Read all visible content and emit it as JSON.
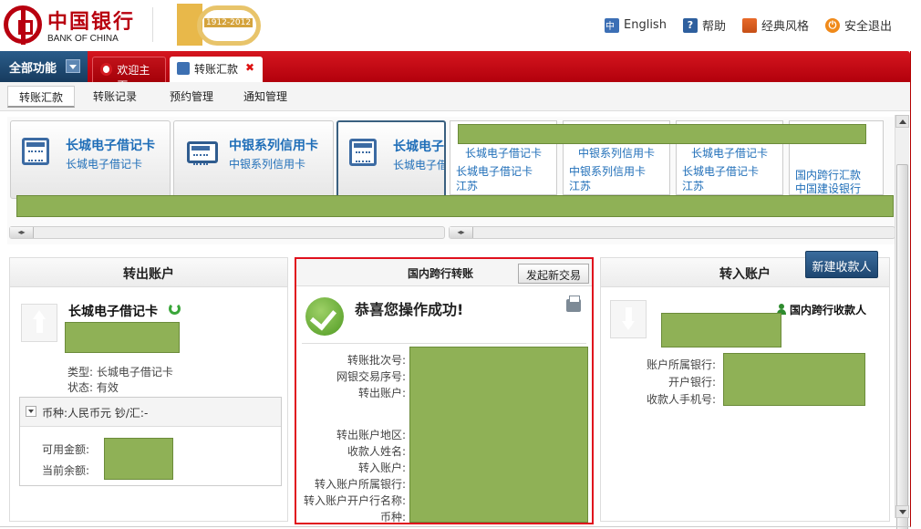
{
  "header": {
    "logo_cn": "中国银行",
    "logo_en": "BANK OF CHINA",
    "anniversary": "1912-2012",
    "links": {
      "english": "English",
      "help": "帮助",
      "classic": "经典风格",
      "logout": "安全退出"
    }
  },
  "tabbar": {
    "all_functions": "全部功能",
    "tabs": [
      {
        "label": "欢迎主页",
        "icon": "home-icon"
      },
      {
        "label": "转账汇款",
        "icon": "transfer-icon",
        "close": "✖"
      }
    ]
  },
  "subnav": [
    "转账汇款",
    "转账记录",
    "预约管理",
    "通知管理"
  ],
  "left_cards": [
    {
      "title": "长城电子借记卡",
      "sub": "长城电子借记卡",
      "icon": "debit-card-icon"
    },
    {
      "title": "中银系列信用卡",
      "sub": "中银系列信用卡",
      "icon": "credit-card-icon"
    },
    {
      "title": "长城电子",
      "sub": "长城电子借",
      "icon": "debit-card-icon"
    }
  ],
  "right_cards": [
    {
      "title": "长城电子借记卡",
      "a": "长城电子借记卡",
      "b": "江苏"
    },
    {
      "title": "中银系列信用卡",
      "a": "中银系列信用卡",
      "b": "江苏"
    },
    {
      "title": "长城电子借记卡",
      "a": "长城电子借记卡",
      "b": "江苏"
    },
    {
      "title": "",
      "a": "国内跨行汇款",
      "b": "中国建设银行"
    }
  ],
  "scroll_arrows": "◂▸",
  "left_panel": {
    "title": "转出账户",
    "account_name": "长城电子借记卡",
    "type_label": "类型:",
    "type_value": "长城电子借记卡",
    "status_label": "状态:",
    "status_value": "有效",
    "currency_line": "币种:人民币元   钞/汇:-",
    "available_label": "可用金额:",
    "current_label": "当前余额:"
  },
  "middle_panel": {
    "title": "国内跨行转账",
    "new_txn_button": "发起新交易",
    "success": "恭喜您操作成功!",
    "labels": [
      "转账批次号:",
      "网银交易序号:",
      "转出账户:",
      "转出账户地区:",
      "收款人姓名:",
      "转入账户:",
      "转入账户所属银行:",
      "转入账户开户行名称:",
      "币种:"
    ]
  },
  "right_panel": {
    "title": "转入账户",
    "new_payee_button": "新建收款人",
    "payee_type": "国内跨行收款人",
    "labels": [
      "账户所属银行:",
      "开户银行:",
      "收款人手机号:"
    ]
  },
  "colors": {
    "brand_red": "#b8000f",
    "tabbar_red": "#c80a14",
    "link_blue": "#1f6eb8",
    "mask_green": "#8fb156",
    "highlight_red": "#e0101d"
  }
}
